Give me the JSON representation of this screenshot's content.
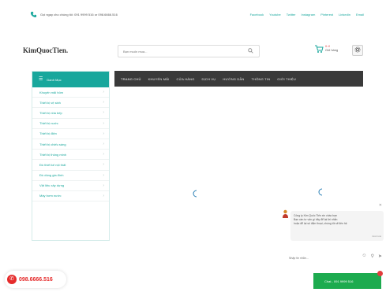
{
  "topbar": {
    "hotline": "Gọi ngay cho chúng tôi: 091 9999 516 or 098.6666.516",
    "social": [
      "Facebook",
      "Youtube",
      "Twitter",
      "Instagram",
      "Pinterest",
      "Linkedin",
      "Email"
    ]
  },
  "header": {
    "logo": "KimQuocTien.",
    "search_placeholder": "Bạn muốn mua...",
    "cart_count": "0 đ",
    "cart_label": "Giỏ hàng"
  },
  "category_menu": {
    "title": "Danh Mục",
    "items": [
      "Khuyến mãi hôm",
      "Thiết bị vệ sinh",
      "Thiết bị nhà bếp",
      "Thiết bị nước",
      "Thiết bị điện",
      "Thiết bị chiếu sáng",
      "Thiết bị thông minh",
      "Đồ thiết kế nội thất",
      "Đồ dùng gia đình",
      "Vật liệu xây dựng",
      "Máy bơm nước"
    ]
  },
  "nav": {
    "items": [
      "TRANG CHỦ",
      "KHUYẾN MÃI",
      "CỬA HÀNG",
      "DỊCH VỤ",
      "HƯỚNG DẪN",
      "THÔNG TIN",
      "GIỚI THIỆU"
    ]
  },
  "chat": {
    "message_lines": [
      "Công ty Kim Quốc Tiến xin chào bạn",
      "Bạn cần tư vấn gì hãy để lại lời nhắn",
      "hoặc để lại số điện thoại, chúng tôi sẽ liên hệ"
    ],
    "time": "Just now",
    "input_placeholder": "Nhập tin nhắn..."
  },
  "call_button": {
    "number": "098.6666.516"
  },
  "chat_bar": {
    "label": "Chat - 091 9999 516"
  },
  "colors": {
    "accent": "#18a79c",
    "nav_bg": "#3a3a3a",
    "hotline_red": "#e52b2b",
    "chat_green": "#1dab4f"
  }
}
